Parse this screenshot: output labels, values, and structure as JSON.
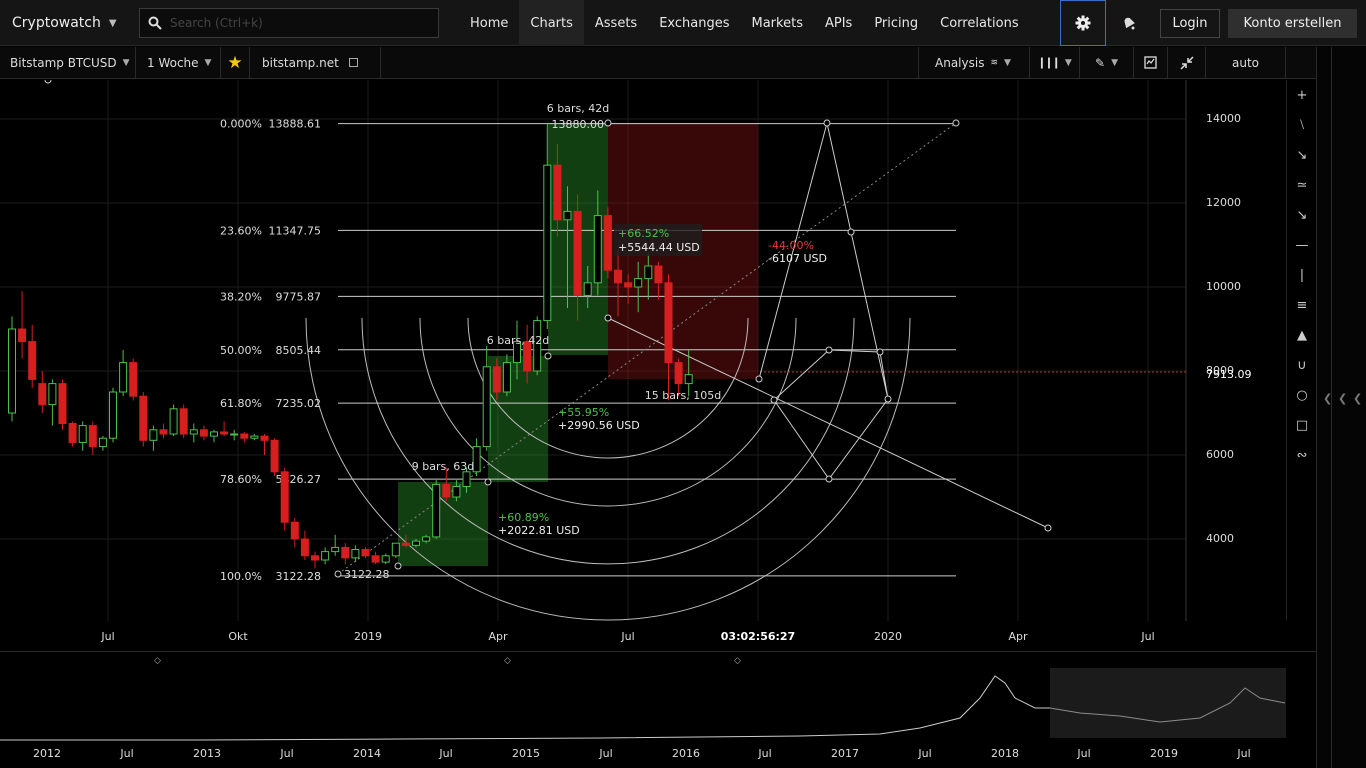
{
  "nav": {
    "brand": "Cryptowatch",
    "search_placeholder": "Search (Ctrl+k)",
    "links": [
      "Home",
      "Charts",
      "Assets",
      "Exchanges",
      "Markets",
      "APIs",
      "Pricing",
      "Correlations"
    ],
    "active": "Charts",
    "login": "Login",
    "signup": "Konto erstellen"
  },
  "toolbar": {
    "pair": "Bitstamp BTCUSD",
    "interval": "1 Woche",
    "exchange": "bitstamp.net",
    "analysis": "Analysis",
    "scale": "auto"
  },
  "chart_data": {
    "type": "candlestick",
    "yaxis_ticks": [
      14000,
      12000,
      10000,
      8000,
      6000,
      4000
    ],
    "yaxis_labels": [
      "14000",
      "12000",
      "10000",
      "8000",
      "6000",
      "4000"
    ],
    "current_price": "7913.09",
    "xaxis_labels": [
      "Jul",
      "Okt",
      "2019",
      "Apr",
      "Jul",
      "03:02:56:27",
      "2020",
      "Apr",
      "Jul"
    ],
    "fib_levels": [
      {
        "pct": "0.000%",
        "price": "13888.61"
      },
      {
        "pct": "23.60%",
        "price": "11347.75"
      },
      {
        "pct": "38.20%",
        "price": "9775.87"
      },
      {
        "pct": "50.00%",
        "price": "8505.44"
      },
      {
        "pct": "61.80%",
        "price": "7235.02"
      },
      {
        "pct": "78.60%",
        "price": "5426.27"
      },
      {
        "pct": "100.0%",
        "price": "3122.28"
      }
    ],
    "annotations": {
      "bars1": "6 bars, 42d",
      "high_label": "13880.00",
      "up1_pct": "+66.52%",
      "up1_usd": "+5544.44 USD",
      "down_pct": "-44.00%",
      "down_usd": "-6107 USD",
      "bars2": "6 bars, 42d",
      "up2_pct": "+55.95%",
      "up2_usd": "+2990.56 USD",
      "bars3": "15 bars, 105d",
      "bars4": "9 bars, 63d",
      "up3_pct": "+60.89%",
      "up3_usd": "+2022.81 USD",
      "low_label": "3122.28"
    },
    "candles": [
      [
        7000,
        9300,
        6800,
        9000
      ],
      [
        9000,
        9900,
        8300,
        8700
      ],
      [
        8700,
        9100,
        7600,
        7800
      ],
      [
        7700,
        8000,
        7000,
        7200
      ],
      [
        7200,
        7800,
        6700,
        7700
      ],
      [
        7700,
        7800,
        6600,
        6750
      ],
      [
        6750,
        6800,
        6200,
        6300
      ],
      [
        6300,
        6800,
        6100,
        6700
      ],
      [
        6700,
        6800,
        6000,
        6200
      ],
      [
        6200,
        6450,
        6100,
        6400
      ],
      [
        6400,
        7600,
        6300,
        7500
      ],
      [
        7500,
        8500,
        7400,
        8200
      ],
      [
        8200,
        8300,
        7300,
        7400
      ],
      [
        7400,
        7500,
        6200,
        6350
      ],
      [
        6350,
        6700,
        6100,
        6600
      ],
      [
        6600,
        6750,
        6400,
        6500
      ],
      [
        6500,
        7200,
        6450,
        7100
      ],
      [
        7100,
        7200,
        6400,
        6500
      ],
      [
        6500,
        6750,
        6300,
        6600
      ],
      [
        6600,
        6700,
        6350,
        6450
      ],
      [
        6450,
        6600,
        6300,
        6550
      ],
      [
        6550,
        6800,
        6450,
        6500
      ],
      [
        6500,
        6600,
        6350,
        6500
      ],
      [
        6500,
        6550,
        6300,
        6400
      ],
      [
        6400,
        6500,
        6350,
        6450
      ],
      [
        6450,
        6500,
        6000,
        6350
      ],
      [
        6350,
        6400,
        5500,
        5600
      ],
      [
        5600,
        5700,
        4200,
        4400
      ],
      [
        4400,
        4500,
        3800,
        4000
      ],
      [
        4000,
        4200,
        3500,
        3600
      ],
      [
        3600,
        3700,
        3300,
        3500
      ],
      [
        3500,
        3800,
        3400,
        3700
      ],
      [
        3700,
        4100,
        3600,
        3800
      ],
      [
        3800,
        3900,
        3400,
        3550
      ],
      [
        3550,
        3850,
        3450,
        3750
      ],
      [
        3750,
        3800,
        3550,
        3600
      ],
      [
        3600,
        3700,
        3400,
        3450
      ],
      [
        3450,
        3650,
        3400,
        3600
      ],
      [
        3600,
        3900,
        3550,
        3900
      ],
      [
        3900,
        4100,
        3800,
        3850
      ],
      [
        3850,
        4000,
        3800,
        3950
      ],
      [
        3950,
        4100,
        3900,
        4050
      ],
      [
        4050,
        5400,
        4000,
        5300
      ],
      [
        5300,
        5700,
        4900,
        5000
      ],
      [
        5000,
        5400,
        4900,
        5250
      ],
      [
        5250,
        5700,
        5100,
        5600
      ],
      [
        5600,
        6400,
        5500,
        6200
      ],
      [
        6200,
        8600,
        6100,
        8100
      ],
      [
        8100,
        8300,
        7300,
        7500
      ],
      [
        7500,
        8400,
        7400,
        8200
      ],
      [
        8200,
        9200,
        7800,
        8700
      ],
      [
        8700,
        9100,
        7700,
        8000
      ],
      [
        8000,
        9300,
        7900,
        9200
      ],
      [
        9200,
        13900,
        9000,
        12900
      ],
      [
        12900,
        13400,
        11200,
        11600
      ],
      [
        11600,
        12400,
        9500,
        11800
      ],
      [
        11800,
        12200,
        9200,
        9800
      ],
      [
        9800,
        10500,
        9500,
        10100
      ],
      [
        10100,
        12300,
        9800,
        11700
      ],
      [
        11700,
        11900,
        10200,
        10400
      ],
      [
        10400,
        10900,
        9300,
        10100
      ],
      [
        10100,
        10300,
        9600,
        10000
      ],
      [
        10000,
        10600,
        9400,
        10200
      ],
      [
        10200,
        10800,
        9700,
        10500
      ],
      [
        10500,
        10600,
        9700,
        10100
      ],
      [
        10100,
        10300,
        7300,
        8200
      ],
      [
        8200,
        8300,
        7400,
        7700
      ],
      [
        7700,
        8500,
        7400,
        7913
      ]
    ]
  },
  "overview": {
    "labels": [
      "2012",
      "Jul",
      "2013",
      "Jul",
      "2014",
      "Jul",
      "2015",
      "Jul",
      "2016",
      "Jul",
      "2017",
      "Jul",
      "2018",
      "Jul",
      "2019",
      "Jul"
    ]
  }
}
